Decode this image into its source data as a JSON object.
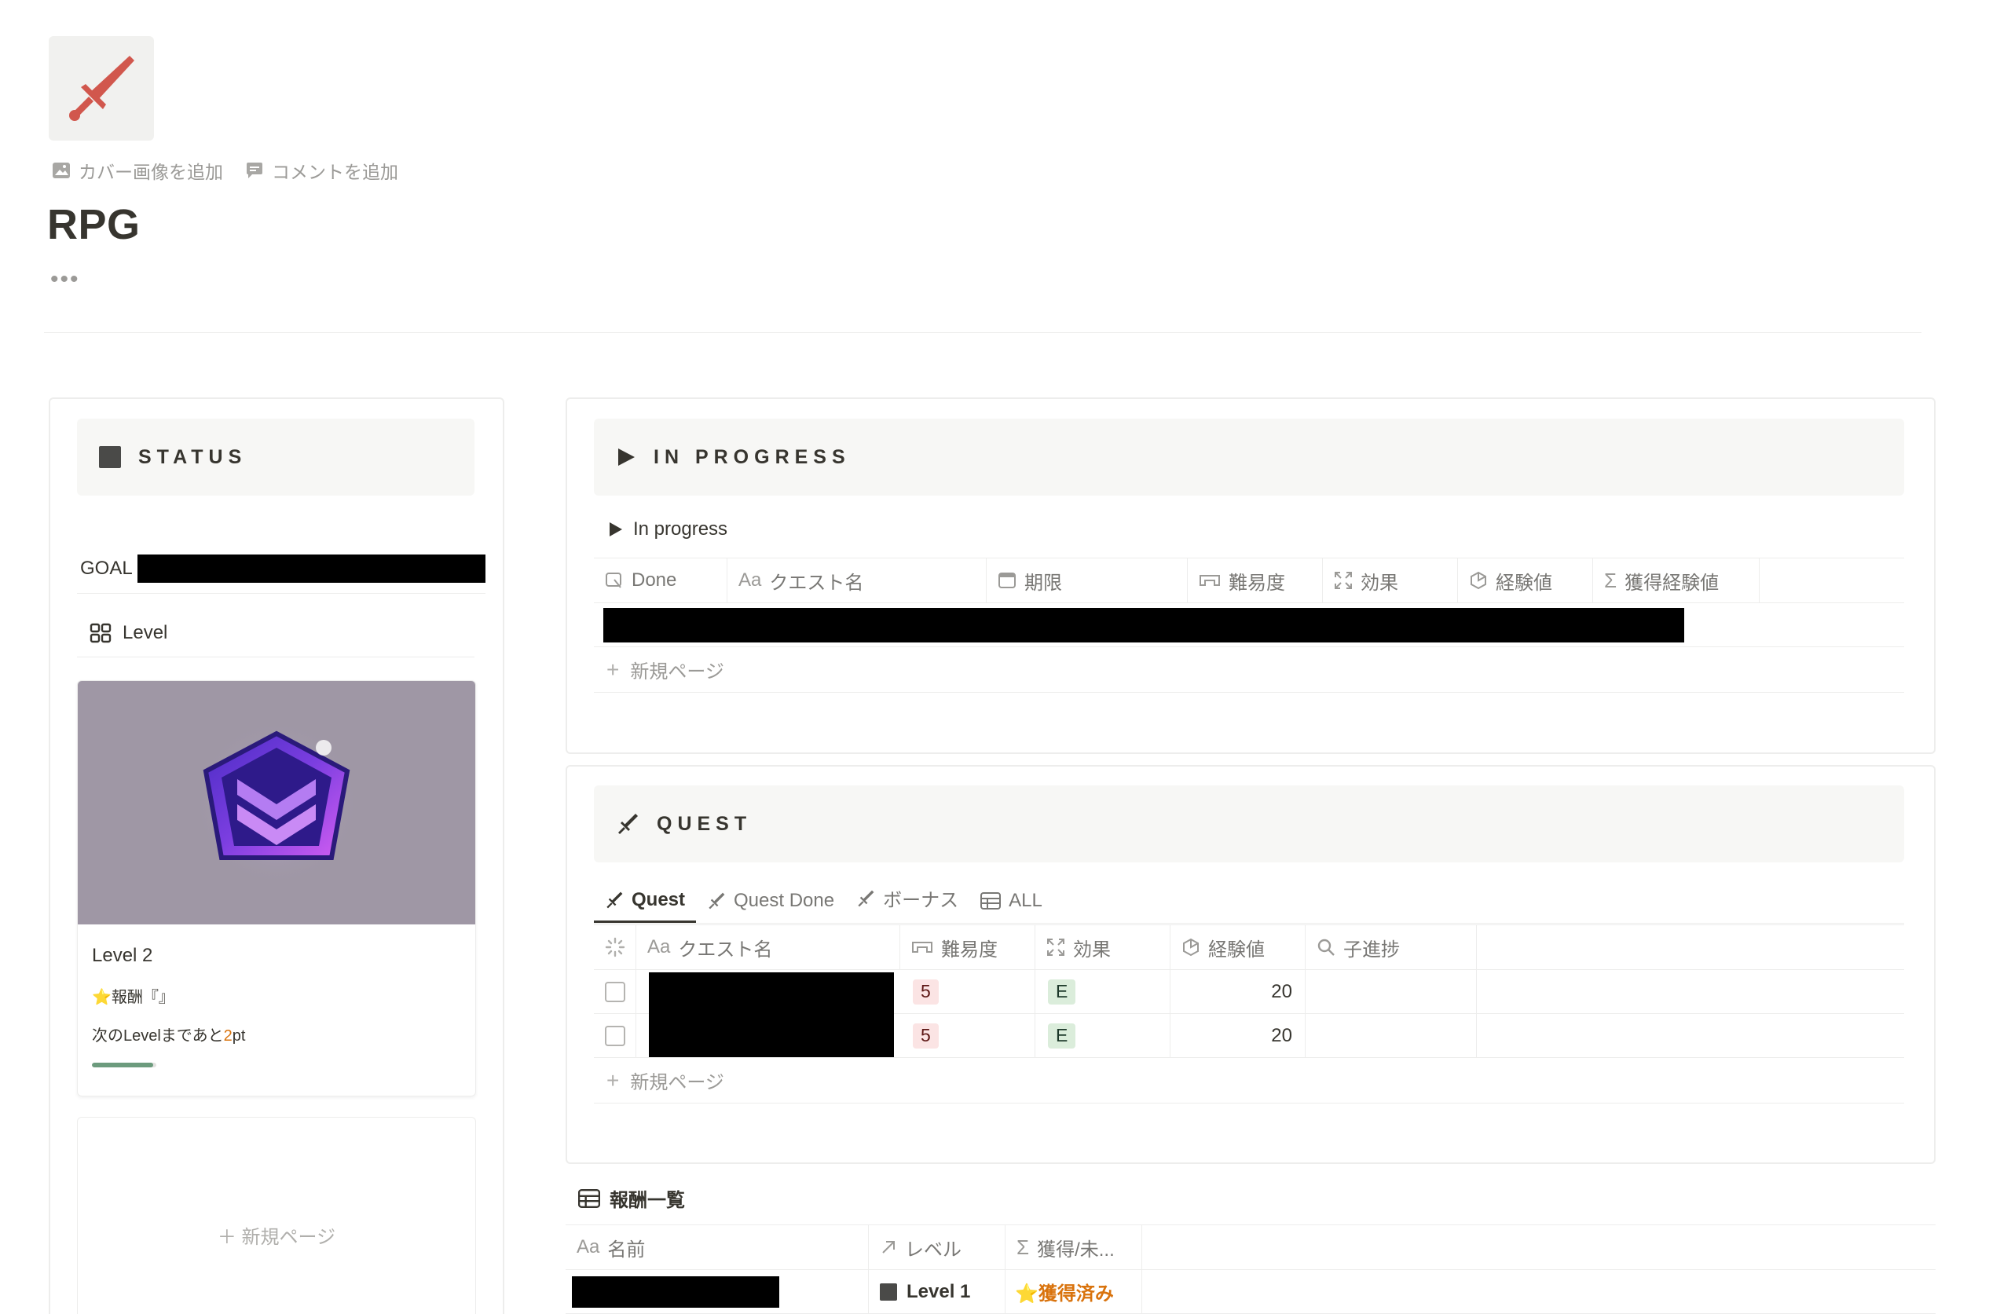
{
  "page": {
    "title": "RPG",
    "add_cover": "カバー画像を追加",
    "add_comment": "コメントを追加",
    "more": "•••"
  },
  "status": {
    "header": "STATUS",
    "goal_label": "GOAL",
    "level_view": "Level",
    "level_card": {
      "title": "Level 2",
      "reward": "⭐報酬『』",
      "next_prefix": "次のLevelまであと",
      "next_value": "2",
      "next_suffix": "pt",
      "progress": 0.95
    },
    "new_page": "＋ 新規ページ"
  },
  "in_progress": {
    "header": "IN PROGRESS",
    "toggle_label": "In progress",
    "columns": [
      "Done",
      "クエスト名",
      "期限",
      "難易度",
      "効果",
      "経験値",
      "獲得経験値"
    ],
    "column_prefix_aa": "Aa",
    "new_page": "新規ページ"
  },
  "quest": {
    "header": "QUEST",
    "tabs": [
      "Quest",
      "Quest Done",
      "ボーナス",
      "ALL"
    ],
    "columns": [
      "クエスト名",
      "難易度",
      "効果",
      "経験値",
      "子進捗"
    ],
    "column_prefix_aa": "Aa",
    "rows": [
      {
        "difficulty": "5",
        "effect": "E",
        "exp": "20"
      },
      {
        "difficulty": "5",
        "effect": "E",
        "exp": "20"
      }
    ],
    "new_page": "新規ページ"
  },
  "rewards": {
    "header": "報酬一覧",
    "columns": [
      "名前",
      "レベル",
      "獲得/未..."
    ],
    "column_prefix_aa": "Aa",
    "rows": [
      {
        "level": "Level 1",
        "status": "⭐獲得済み"
      }
    ]
  },
  "colors": {
    "accent_sword": "#d1574d",
    "status_orange": "#d9730d",
    "progress_green": "#6c9b7d",
    "level_card_bg": "#9f97a5"
  }
}
